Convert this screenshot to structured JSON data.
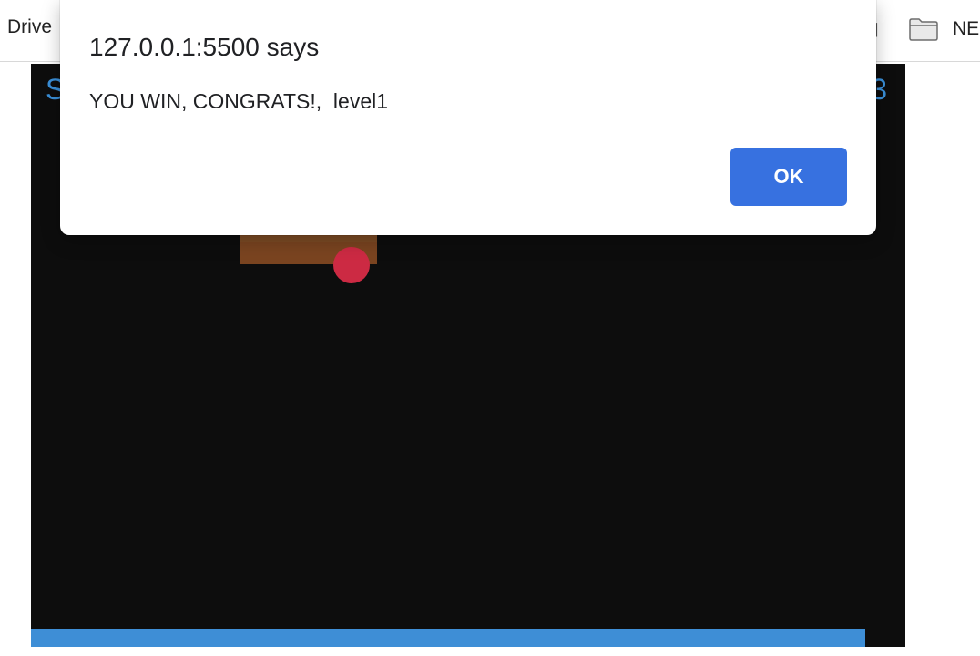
{
  "bookmarks": {
    "left_label": "Drive",
    "right_label": "NE",
    "right_icon": "folder-icon"
  },
  "game": {
    "hud_left": "S",
    "hud_right": "3",
    "colors": {
      "background": "#0d0d0d",
      "hud": "#3a8fd8",
      "brick": "#7a4420",
      "ball": "#cc2a43",
      "paddle": "#3e8ed6"
    }
  },
  "alert": {
    "title": "127.0.0.1:5500 says",
    "message": "YOU WIN, CONGRATS!,  level1",
    "ok_label": "OK",
    "button_color": "#3771e0"
  }
}
